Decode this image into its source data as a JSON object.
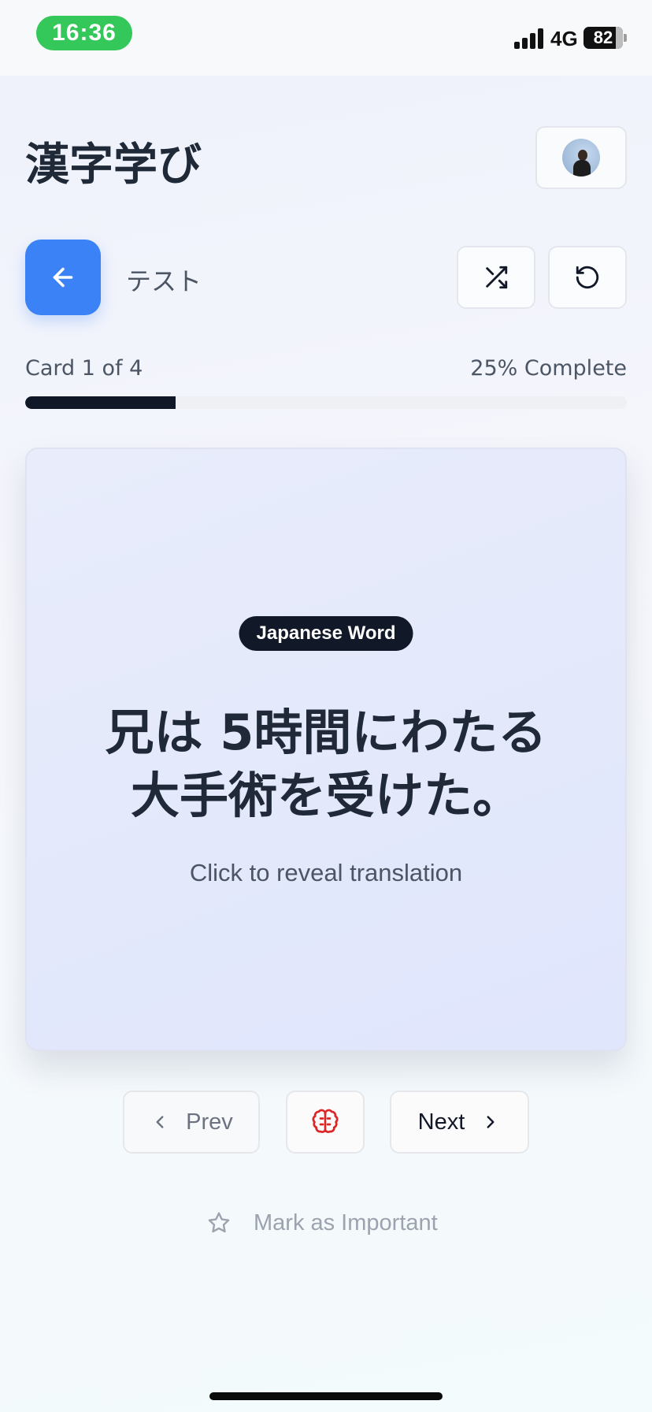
{
  "status_bar": {
    "time": "16:36",
    "network": "4G",
    "battery": "82"
  },
  "header": {
    "title": "漢字学び",
    "avatar_icon": "user-avatar"
  },
  "toolbar": {
    "back_icon": "arrow-left-icon",
    "deck_name": "テスト",
    "shuffle_icon": "shuffle-icon",
    "reset_icon": "rotate-ccw-icon"
  },
  "progress": {
    "card_label": "Card 1 of 4",
    "complete_label": "25% Complete",
    "fraction": 0.25
  },
  "card": {
    "badge": "Japanese Word",
    "word_line1": "兄は 5時間にわたる",
    "word_line2": "大手術を受けた。",
    "hint": "Click to reveal translation"
  },
  "navigation": {
    "prev_label": "Prev",
    "next_label": "Next",
    "brain_icon": "brain-icon",
    "brain_color": "#dc2626"
  },
  "mark_important": {
    "label": "Mark as Important",
    "icon": "star-icon"
  },
  "colors": {
    "accent": "#3b82f6",
    "progress_fill": "#101828",
    "status_pill": "#34c759"
  }
}
